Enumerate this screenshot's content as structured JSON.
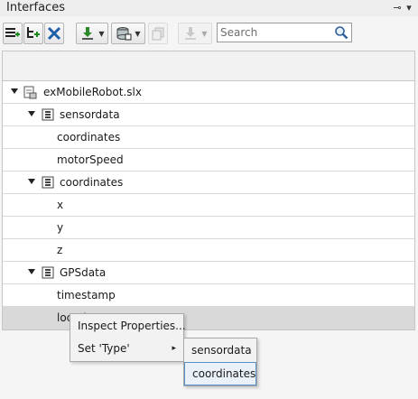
{
  "window": {
    "title": "Interfaces"
  },
  "controls": {
    "pin_glyph": "⊸",
    "menu_glyph": "▾"
  },
  "toolbar": {
    "buttons": [
      {
        "icon": "add-interface-icon",
        "has_dropdown": false,
        "enabled": true
      },
      {
        "icon": "add-element-icon",
        "has_dropdown": false,
        "enabled": true
      },
      {
        "icon": "delete-icon",
        "has_dropdown": false,
        "enabled": true
      },
      {
        "icon": "import-icon",
        "has_dropdown": true,
        "enabled": true
      },
      {
        "icon": "dictionary-icon",
        "has_dropdown": true,
        "enabled": true
      },
      {
        "icon": "copy-icon",
        "has_dropdown": false,
        "enabled": false
      },
      {
        "icon": "export-icon",
        "has_dropdown": true,
        "enabled": false
      }
    ],
    "search": {
      "placeholder": "Search",
      "value": ""
    }
  },
  "tree": {
    "rows": [
      {
        "label": "exMobileRobot.slx",
        "level": 0,
        "expandable": true,
        "icon": "model-file-icon"
      },
      {
        "label": "sensordata",
        "level": 1,
        "expandable": true,
        "icon": "interface-icon"
      },
      {
        "label": "coordinates",
        "level": 2,
        "expandable": false
      },
      {
        "label": "motorSpeed",
        "level": 2,
        "expandable": false
      },
      {
        "label": "coordinates",
        "level": 1,
        "expandable": true,
        "icon": "interface-icon"
      },
      {
        "label": "x",
        "level": 2,
        "expandable": false
      },
      {
        "label": "y",
        "level": 2,
        "expandable": false
      },
      {
        "label": "z",
        "level": 2,
        "expandable": false
      },
      {
        "label": "GPSdata",
        "level": 1,
        "expandable": true,
        "icon": "interface-icon"
      },
      {
        "label": "timestamp",
        "level": 2,
        "expandable": false
      },
      {
        "label": "location",
        "level": 2,
        "expandable": false,
        "selected": true
      }
    ]
  },
  "context_menu": {
    "items": [
      {
        "label": "Inspect Properties..."
      },
      {
        "label": "Set 'Type'",
        "submenu_arrow": "▸"
      }
    ],
    "submenu": {
      "items": [
        {
          "label": "sensordata"
        },
        {
          "label": "coordinates",
          "hover": true
        }
      ]
    }
  }
}
